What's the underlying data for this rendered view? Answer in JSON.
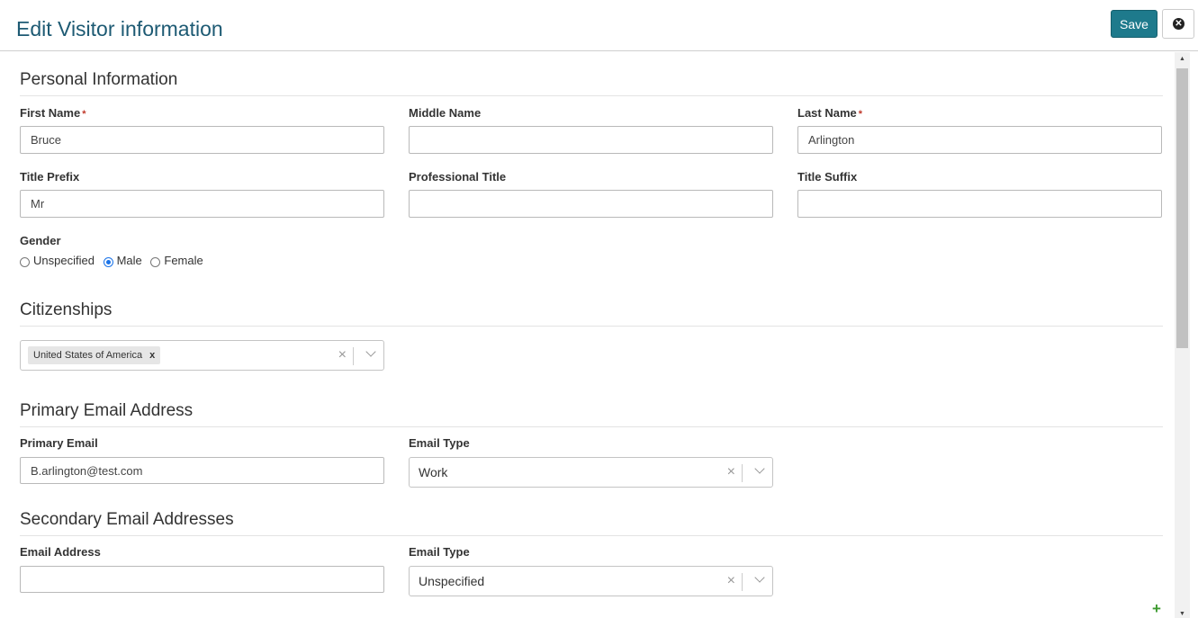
{
  "header": {
    "title": "Edit Visitor information",
    "save_label": "Save",
    "close_icon": "close-circle-icon"
  },
  "personal": {
    "section_title": "Personal Information",
    "first_name": {
      "label": "First Name",
      "value": "Bruce",
      "required": true
    },
    "middle_name": {
      "label": "Middle Name",
      "value": ""
    },
    "last_name": {
      "label": "Last Name",
      "value": "Arlington",
      "required": true
    },
    "title_prefix": {
      "label": "Title Prefix",
      "value": "Mr"
    },
    "professional_title": {
      "label": "Professional Title",
      "value": ""
    },
    "title_suffix": {
      "label": "Title Suffix",
      "value": ""
    },
    "gender": {
      "label": "Gender",
      "options": [
        "Unspecified",
        "Male",
        "Female"
      ],
      "selected": "Male"
    },
    "required_marker": "*"
  },
  "citizenships": {
    "section_title": "Citizenships",
    "tags": [
      "United States of America"
    ],
    "tag_remove": "x",
    "clear": "×"
  },
  "primary_email": {
    "section_title": "Primary Email Address",
    "email_label": "Primary Email",
    "email_value": "B.arlington@test.com",
    "type_label": "Email Type",
    "type_value": "Work",
    "clear": "×"
  },
  "secondary_email": {
    "section_title": "Secondary Email Addresses",
    "email_label": "Email Address",
    "email_value": "",
    "type_label": "Email Type",
    "type_value": "Unspecified",
    "clear": "×",
    "add_label": "+"
  },
  "colors": {
    "title": "#1d5a73",
    "save_button": "#1e7a8c",
    "required": "#c0392b",
    "add": "#3c9a2f"
  }
}
